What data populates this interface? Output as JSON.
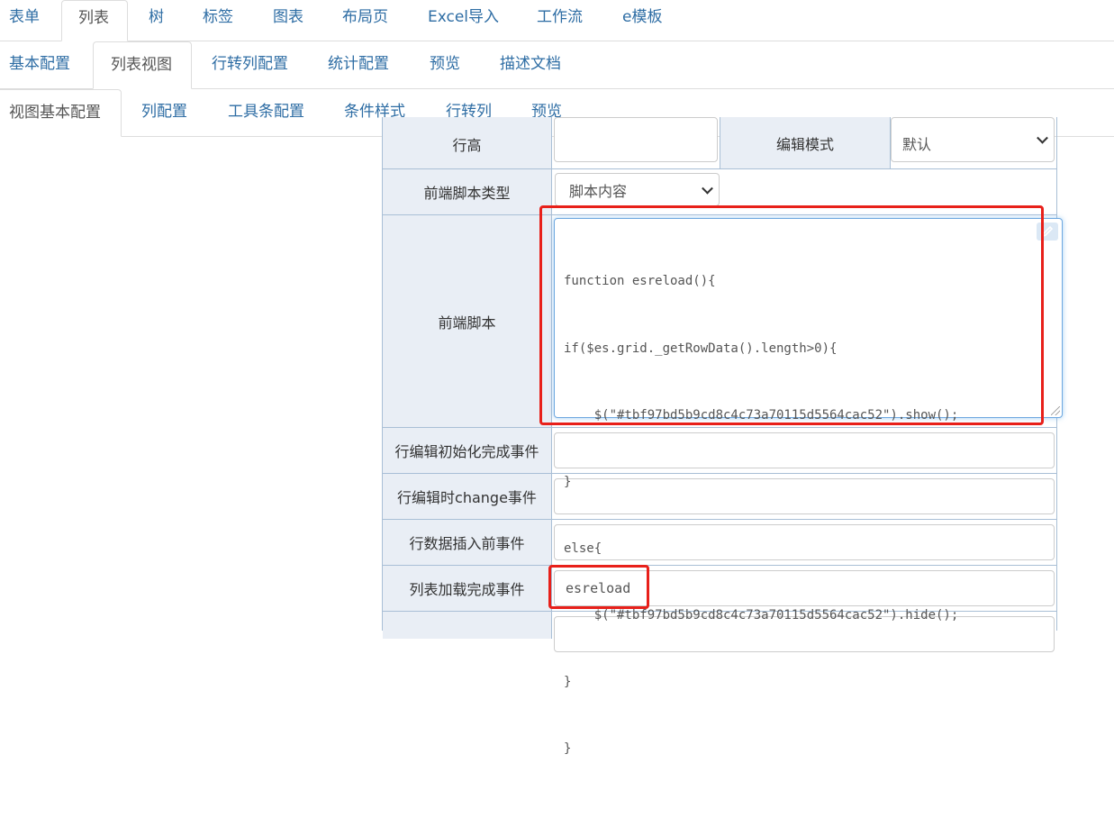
{
  "tabs_level1": [
    "表单",
    "列表",
    "树",
    "标签",
    "图表",
    "布局页",
    "Excel导入",
    "工作流",
    "e模板"
  ],
  "tabs_level1_active": 1,
  "tabs_level2": [
    "基本配置",
    "列表视图",
    "行转列配置",
    "统计配置",
    "预览",
    "描述文档"
  ],
  "tabs_level2_active": 1,
  "tabs_level3": [
    "视图基本配置",
    "列配置",
    "工具条配置",
    "条件样式",
    "行转列",
    "预览"
  ],
  "tabs_level3_active": 0,
  "form": {
    "row_height_label": "行高",
    "row_height_value": "",
    "edit_mode_label": "编辑模式",
    "edit_mode_value": "默认",
    "script_type_label": "前端脚本类型",
    "script_type_value": "脚本内容",
    "script_label": "前端脚本",
    "script_lines": [
      "function esreload(){",
      "if($es.grid._getRowData().length>0){",
      "    $(\"#tbf97bd5b9cd8c4c73a70115d5564cac52\").show();",
      "}",
      "else{",
      "    $(\"#tbf97bd5b9cd8c4c73a70115d5564cac52\").hide();",
      "}",
      "}"
    ],
    "row_edit_init_label": "行编辑初始化完成事件",
    "row_edit_init_value": "",
    "row_edit_change_label": "行编辑时change事件",
    "row_edit_change_value": "",
    "before_insert_label": "行数据插入前事件",
    "before_insert_value": "",
    "load_complete_label": "列表加载完成事件",
    "load_complete_value": "esreload"
  },
  "colors": {
    "tab_link": "#2e6da4",
    "label_bg": "#e9eef5",
    "table_border": "#a9bfd6",
    "highlight": "#e8201a"
  }
}
